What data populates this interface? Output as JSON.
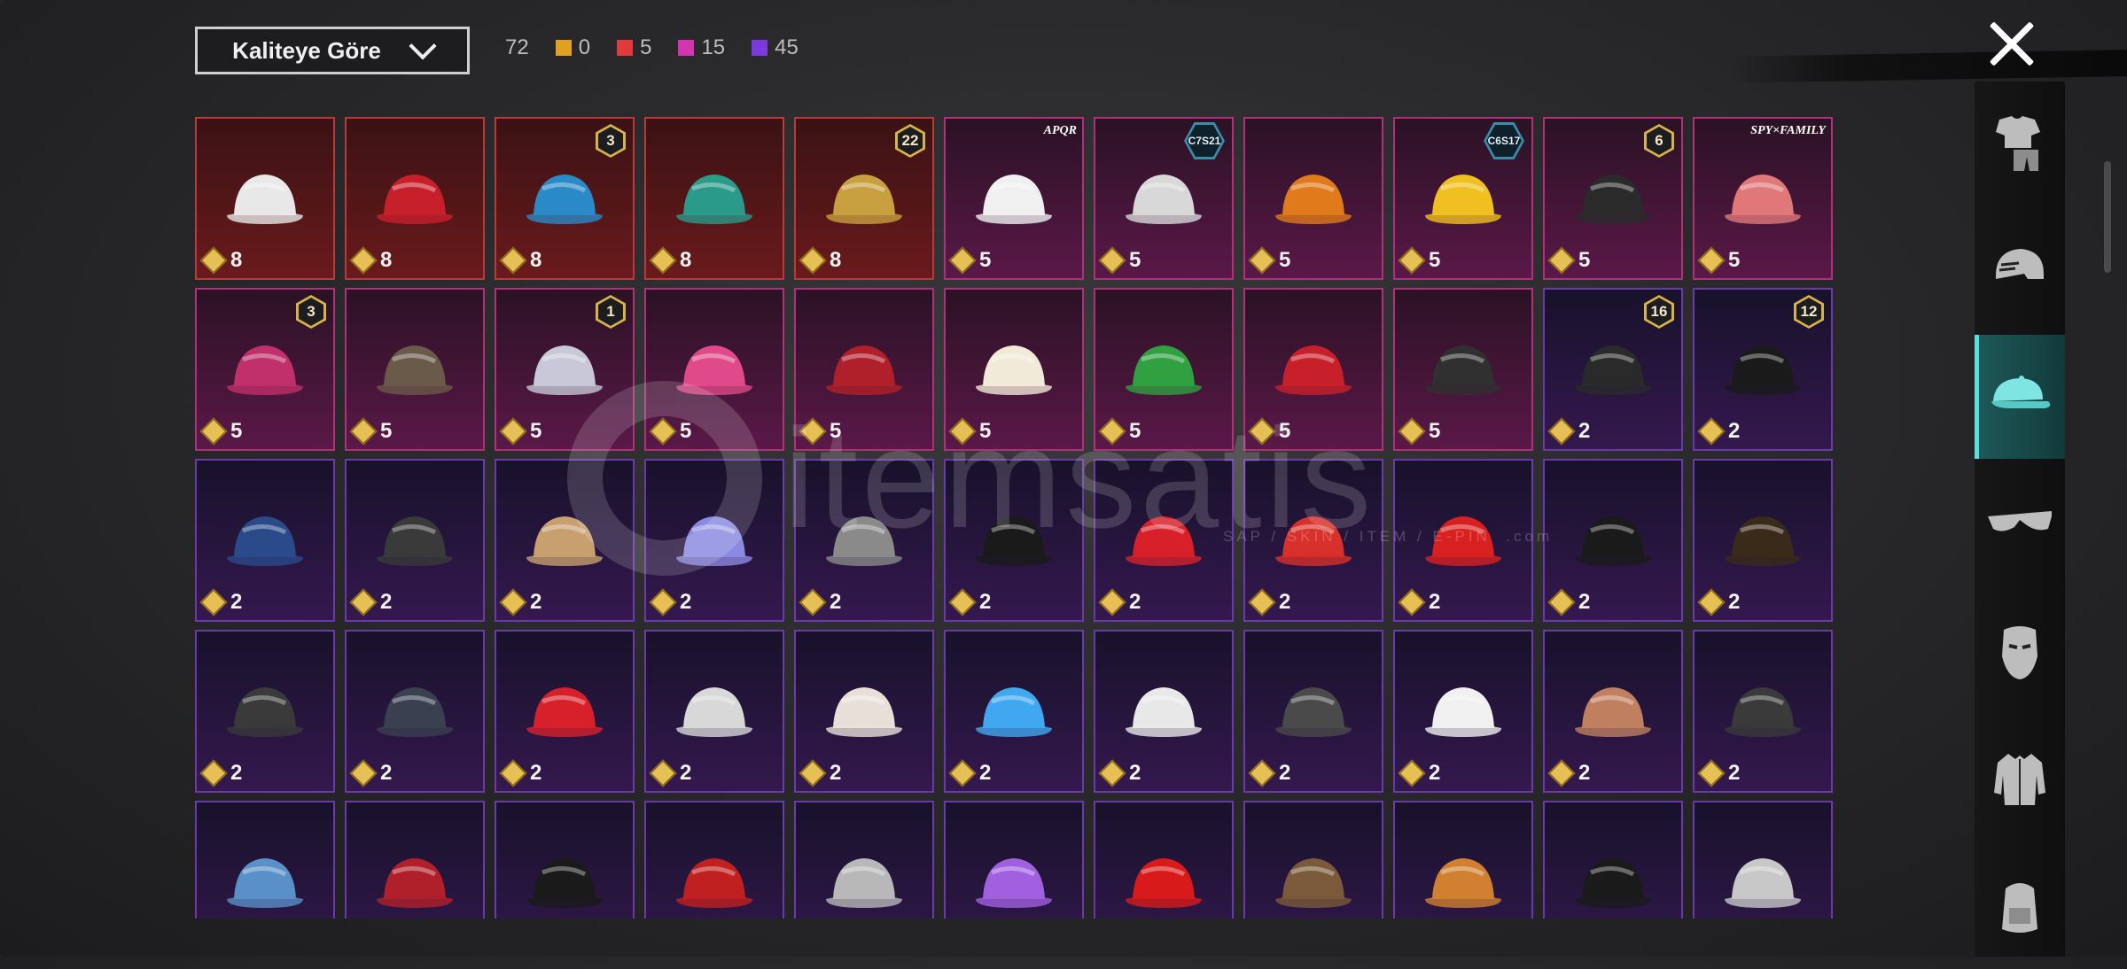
{
  "header": {
    "sort_label": "Kaliteye Göre",
    "total_count": "72",
    "quality_counts": [
      {
        "color": "#e0a020",
        "count": "0"
      },
      {
        "color": "#e23a3a",
        "count": "5"
      },
      {
        "color": "#d434b0",
        "count": "15"
      },
      {
        "color": "#7a3ae0",
        "count": "45"
      }
    ]
  },
  "watermark": {
    "brand": "itemsatis",
    "tagline": "SAP / SKIN / ITEM / E-PIN",
    "domain": ".com"
  },
  "sidebar": {
    "tabs": [
      {
        "icon": "outfit-icon",
        "active": false
      },
      {
        "icon": "helmet-icon",
        "active": false
      },
      {
        "icon": "cap-icon",
        "active": true
      },
      {
        "icon": "glasses-icon",
        "active": false
      },
      {
        "icon": "mask-icon",
        "active": false
      },
      {
        "icon": "jacket-icon",
        "active": false
      },
      {
        "icon": "backpack-icon",
        "active": false
      }
    ]
  },
  "items": [
    {
      "name": "white-cowboy-hat",
      "quality": "red",
      "cost": "8",
      "badge": ""
    },
    {
      "name": "red-helmet",
      "quality": "red",
      "cost": "8",
      "badge": ""
    },
    {
      "name": "blue-hair-joker",
      "quality": "red",
      "cost": "8",
      "badge": "3"
    },
    {
      "name": "green-dragon-helmet",
      "quality": "red",
      "cost": "8",
      "badge": ""
    },
    {
      "name": "gold-knight-helmet",
      "quality": "red",
      "cost": "8",
      "badge": "22"
    },
    {
      "name": "panda-head",
      "quality": "pink",
      "cost": "5",
      "brand": "APQR"
    },
    {
      "name": "white-fur-hat",
      "quality": "pink",
      "cost": "5",
      "season": "C7S21"
    },
    {
      "name": "pumpkin-head",
      "quality": "pink",
      "cost": "5",
      "badge": ""
    },
    {
      "name": "visor-fur-cap",
      "quality": "pink",
      "cost": "5",
      "season": "C6S17"
    },
    {
      "name": "black-gold-helmet",
      "quality": "pink",
      "cost": "5",
      "badge": "6"
    },
    {
      "name": "pink-hair-wig",
      "quality": "pink",
      "cost": "5",
      "brand": "SPY×FAMILY"
    },
    {
      "name": "jester-hat",
      "quality": "pink",
      "cost": "5",
      "badge": "3"
    },
    {
      "name": "spiked-helmet",
      "quality": "pink",
      "cost": "5",
      "badge": ""
    },
    {
      "name": "silver-pigtails",
      "quality": "pink",
      "cost": "5",
      "badge": "1"
    },
    {
      "name": "pink-cat-mask",
      "quality": "pink",
      "cost": "5",
      "badge": ""
    },
    {
      "name": "red-crown-head",
      "quality": "pink",
      "cost": "5",
      "badge": ""
    },
    {
      "name": "sheep-head",
      "quality": "pink",
      "cost": "5",
      "badge": ""
    },
    {
      "name": "frog-cap",
      "quality": "pink",
      "cost": "5",
      "badge": ""
    },
    {
      "name": "devil-horns",
      "quality": "pink",
      "cost": "5",
      "badge": ""
    },
    {
      "name": "ghost-mask",
      "quality": "pink",
      "cost": "5",
      "badge": ""
    },
    {
      "name": "mohawk-glasses",
      "quality": "purple",
      "cost": "2",
      "badge": "16"
    },
    {
      "name": "bunny-helmet",
      "quality": "purple",
      "cost": "2",
      "badge": "12"
    },
    {
      "name": "blue-cap",
      "quality": "purple",
      "cost": "2",
      "badge": ""
    },
    {
      "name": "gas-mask-helmet",
      "quality": "purple",
      "cost": "2",
      "badge": ""
    },
    {
      "name": "bunny-ear-hat",
      "quality": "purple",
      "cost": "2",
      "badge": ""
    },
    {
      "name": "rainbow-cap",
      "quality": "purple",
      "cost": "2",
      "badge": ""
    },
    {
      "name": "bucket-hat-red-hair",
      "quality": "purple",
      "cost": "2",
      "badge": ""
    },
    {
      "name": "black-cap",
      "quality": "purple",
      "cost": "2",
      "badge": ""
    },
    {
      "name": "red-white-cap",
      "quality": "purple",
      "cost": "2",
      "badge": ""
    },
    {
      "name": "red-cat-ears",
      "quality": "purple",
      "cost": "2",
      "badge": ""
    },
    {
      "name": "red-mohawk",
      "quality": "purple",
      "cost": "2",
      "badge": ""
    },
    {
      "name": "black-sombrero",
      "quality": "purple",
      "cost": "2",
      "badge": ""
    },
    {
      "name": "steampunk-hat",
      "quality": "purple",
      "cost": "2",
      "badge": ""
    },
    {
      "name": "samurai-ponytail",
      "quality": "purple",
      "cost": "2",
      "badge": ""
    },
    {
      "name": "navy-cap",
      "quality": "purple",
      "cost": "2",
      "badge": ""
    },
    {
      "name": "mushroom-hat",
      "quality": "purple",
      "cost": "2",
      "badge": ""
    },
    {
      "name": "white-wide-hat",
      "quality": "purple",
      "cost": "2",
      "badge": ""
    },
    {
      "name": "kabuki-mask",
      "quality": "purple",
      "cost": "2",
      "badge": ""
    },
    {
      "name": "blue-bunny-ears",
      "quality": "purple",
      "cost": "2",
      "badge": ""
    },
    {
      "name": "white-visor",
      "quality": "purple",
      "cost": "2",
      "badge": ""
    },
    {
      "name": "soldier-helmet",
      "quality": "purple",
      "cost": "2",
      "badge": ""
    },
    {
      "name": "feather-hat",
      "quality": "purple",
      "cost": "2",
      "badge": ""
    },
    {
      "name": "straw-cone-hat",
      "quality": "purple",
      "cost": "2",
      "badge": ""
    },
    {
      "name": "wrestler-mask",
      "quality": "purple",
      "cost": "2",
      "badge": ""
    },
    {
      "name": "shark-hood",
      "quality": "purple",
      "cost": "",
      "badge": ""
    },
    {
      "name": "red-beret",
      "quality": "purple",
      "cost": "",
      "badge": ""
    },
    {
      "name": "black-bowler",
      "quality": "purple",
      "cost": "",
      "badge": ""
    },
    {
      "name": "red-fedora",
      "quality": "purple",
      "cost": "",
      "badge": ""
    },
    {
      "name": "shark-mask",
      "quality": "purple",
      "cost": "",
      "badge": ""
    },
    {
      "name": "flower-crown",
      "quality": "purple",
      "cost": "",
      "badge": ""
    },
    {
      "name": "red-bucket-hat",
      "quality": "purple",
      "cost": "",
      "badge": ""
    },
    {
      "name": "cake-hat",
      "quality": "purple",
      "cost": "",
      "badge": ""
    },
    {
      "name": "burger-hat",
      "quality": "purple",
      "cost": "",
      "badge": ""
    },
    {
      "name": "black-beanie",
      "quality": "purple",
      "cost": "",
      "badge": ""
    },
    {
      "name": "head-mirror",
      "quality": "purple",
      "cost": "",
      "badge": ""
    }
  ]
}
